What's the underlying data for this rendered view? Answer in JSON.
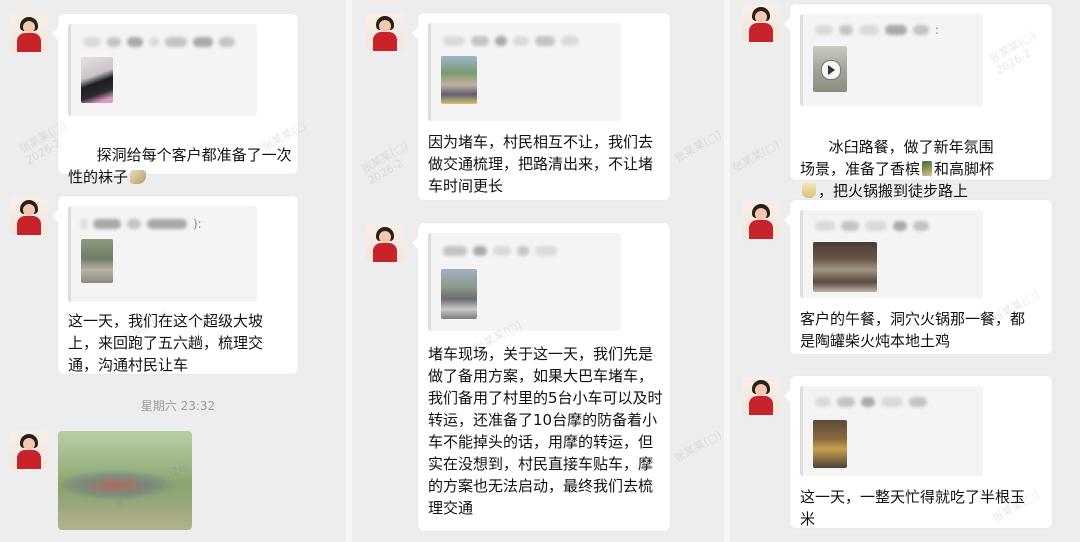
{
  "colors": {
    "background": "#ededed",
    "bubble": "#ffffff",
    "quote_background": "#f4f4f4",
    "timestamp": "#9a9a9a",
    "avatar_shirt": "#c8222b"
  },
  "columns": [
    {
      "messages": [
        {
          "text": "探洞给每个客户都准备了一次性的袜子",
          "emoji": "socks-emoji",
          "quote_thumb": "person-in-dark-coat-photo"
        },
        {
          "text": "这一天，我们在这个超级大坡上，来回跑了五六趟，梳理交通，沟通村民让车",
          "quote_thumb": "mountain-road-photo",
          "quote_colon": "):"
        }
      ],
      "timestamp": "星期六 23:32",
      "image_message": {
        "description_icon": "group-picnic-photo"
      }
    },
    {
      "messages": [
        {
          "text": "因为堵车，村民相互不让，我们去做交通梳理，把路清出来，不让堵车时间更长",
          "quote_thumb": "crowd-on-road-photo"
        },
        {
          "text": "堵车现场，关于这一天，我们先是做了备用方案，如果大巴车堵车，我们备用了村里的5台小车可以及时转运，还准备了10台摩的防备着小车不能掉头的话，用摩的转运，但实在没想到，村民直接车贴车，摩的方案也无法启动，最终我们去梳理交通",
          "quote_thumb": "traffic-jam-photo"
        }
      ]
    },
    {
      "messages": [
        {
          "text_parts": [
            "冰臼路餐，做了新年氛围场景，准备了香槟",
            "和高脚杯",
            "，把火锅搬到徒步路上"
          ],
          "emoji_icons": [
            "champagne-emoji",
            "glasses-emoji"
          ],
          "quote_thumb": "video-thumbnail",
          "quote_colon": ":"
        },
        {
          "text": "客户的午餐，洞穴火锅那一餐，都是陶罐柴火炖本地土鸡",
          "quote_thumb": "cave-lunch-photo"
        },
        {
          "text": "这一天，一整天忙得就吃了半根玉米",
          "quote_thumb": "corn-food-photo"
        }
      ]
    }
  ]
}
